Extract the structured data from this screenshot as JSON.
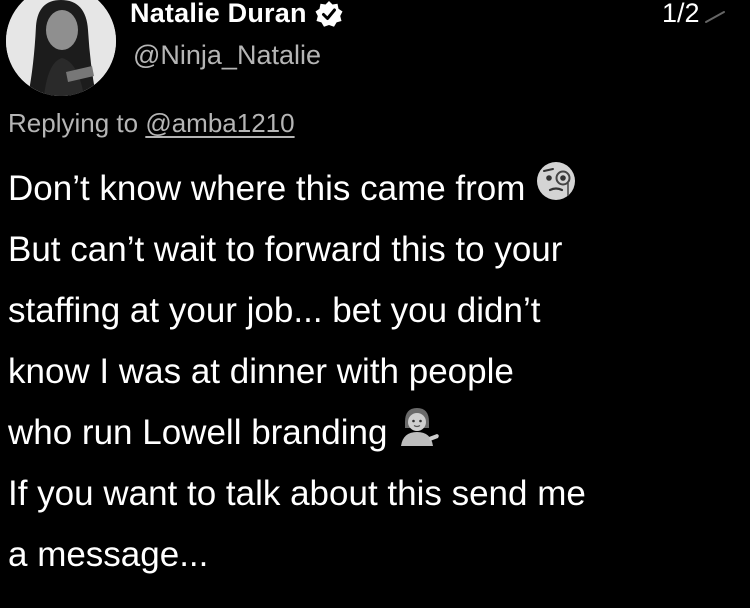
{
  "author": {
    "display_name": "Natalie Duran",
    "handle": "@Ninja_Natalie",
    "verified": true
  },
  "counter": "1/2",
  "reply": {
    "prefix": "Replying to ",
    "mention": "@amba1210"
  },
  "tweet": {
    "lines": [
      "Don’t know where this came from",
      "But can’t wait to forward this to your",
      "staffing at your job... bet you didn’t",
      "know I was at dinner with people",
      "who run Lowell branding",
      "If you want to talk about this send me",
      "a message..."
    ],
    "emojis": [
      "face-with-monocle-emoji",
      "woman-tipping-hand-emoji"
    ]
  },
  "colors": {
    "background": "#000000",
    "text": "#ffffff",
    "secondary_text": "#b5b5b5"
  }
}
